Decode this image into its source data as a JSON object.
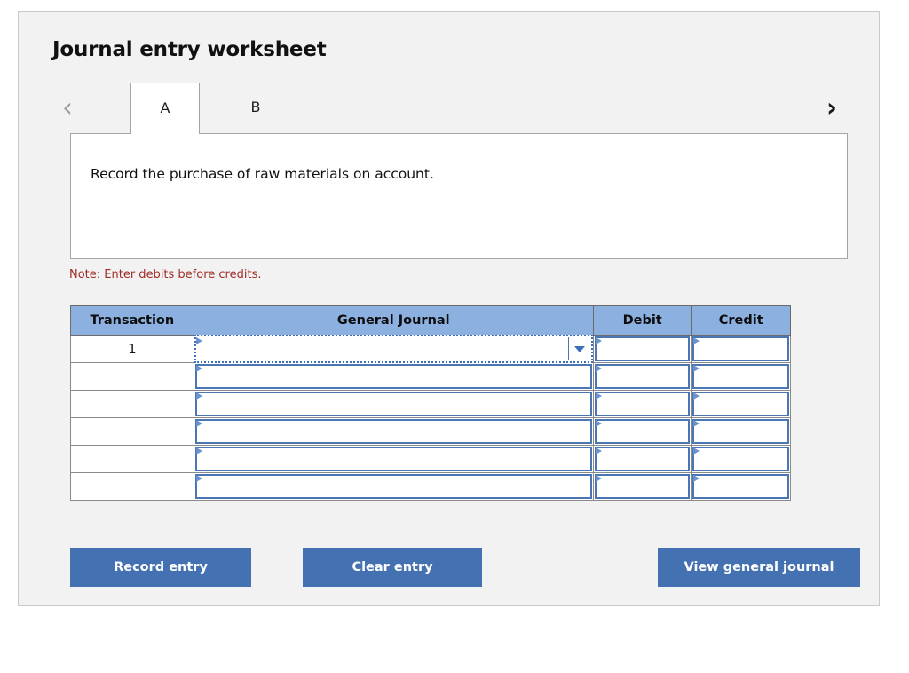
{
  "panel": {
    "title": "Journal entry worksheet"
  },
  "tabs": {
    "prev_arrow_icon": "chevron-left-icon",
    "next_arrow_icon": "chevron-right-icon",
    "items": [
      {
        "label": "A",
        "active": true
      },
      {
        "label": "B",
        "active": false
      }
    ]
  },
  "description": {
    "text": "Record the purchase of raw materials on account."
  },
  "note": {
    "text": "Note: Enter debits before credits."
  },
  "table": {
    "headers": [
      "Transaction",
      "General Journal",
      "Debit",
      "Credit"
    ],
    "rows": [
      {
        "transaction": "1",
        "general_journal": "",
        "debit": "",
        "credit": "",
        "active": true
      },
      {
        "transaction": "",
        "general_journal": "",
        "debit": "",
        "credit": "",
        "active": false
      },
      {
        "transaction": "",
        "general_journal": "",
        "debit": "",
        "credit": "",
        "active": false
      },
      {
        "transaction": "",
        "general_journal": "",
        "debit": "",
        "credit": "",
        "active": false
      },
      {
        "transaction": "",
        "general_journal": "",
        "debit": "",
        "credit": "",
        "active": false
      },
      {
        "transaction": "",
        "general_journal": "",
        "debit": "",
        "credit": "",
        "active": false
      }
    ]
  },
  "buttons": {
    "record_entry": "Record entry",
    "clear_entry": "Clear entry",
    "view_general_journal": "View general journal"
  },
  "colors": {
    "header_blue": "#8cb0e0",
    "button_blue": "#4471b2",
    "note_red": "#9e2b25",
    "panel_bg": "#f2f2f2",
    "cell_border_blue": "#4a77b4"
  }
}
